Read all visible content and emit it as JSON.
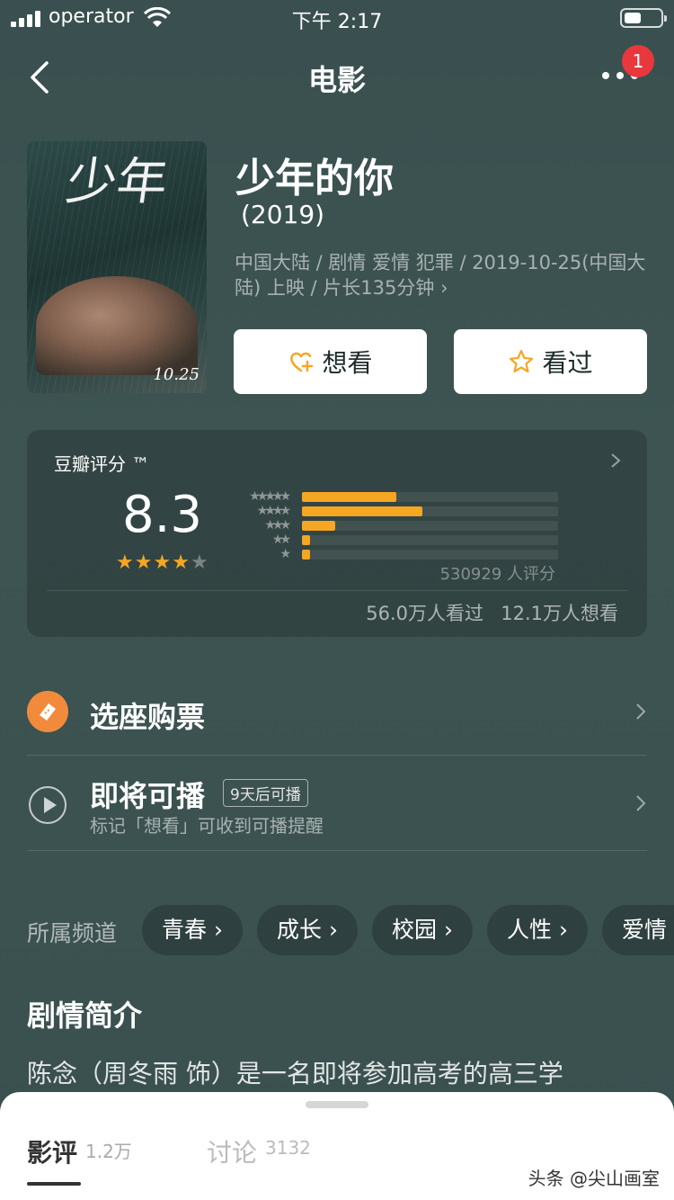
{
  "status_bar": {
    "operator": "operator",
    "time": "下午 2:17"
  },
  "nav": {
    "title": "电影",
    "badge": "1"
  },
  "movie": {
    "title": "少年的你",
    "year": "(2019)",
    "meta": "中国大陆 / 剧情 爱情 犯罪 / 2019-10-25(中国大陆) 上映 / 片长135分钟",
    "poster_date": "10.25",
    "poster_title_glyph": "少年"
  },
  "actions": {
    "want": "想看",
    "seen": "看过"
  },
  "rating": {
    "title": "豆瓣评分 ™",
    "score": "8.3",
    "stars_filled": 4,
    "stars_total": 5,
    "distribution": [
      {
        "stars": "★★★★★",
        "fraction": 0.37
      },
      {
        "stars": "★★★★",
        "fraction": 0.47
      },
      {
        "stars": "★★★",
        "fraction": 0.13
      },
      {
        "stars": "★★",
        "fraction": 0.03
      },
      {
        "stars": "★",
        "fraction": 0.03
      }
    ],
    "count": "530929 人评分",
    "seen": "56.0万人看过",
    "want": "12.1万人想看",
    "bar_color": "#f5a623"
  },
  "rows": {
    "ticket": {
      "title": "选座购票",
      "icon": "ticket-icon"
    },
    "stream": {
      "title": "即将可播",
      "tag": "9天后可播",
      "subtitle": "标记「想看」可收到可播提醒",
      "icon": "play-icon"
    }
  },
  "channels": {
    "label": "所属频道",
    "items": [
      "青春 ›",
      "成长 ›",
      "校园 ›",
      "人性 ›",
      "爱情 ›"
    ]
  },
  "intro": {
    "title": "剧情简介",
    "text": "陈念（周冬雨 饰）是一名即将参加高考的高三学"
  },
  "sheet": {
    "tabs": [
      {
        "label": "影评",
        "count": "1.2万"
      },
      {
        "label": "讨论",
        "count": "3132"
      }
    ]
  },
  "watermark": "头条 @尖山画室"
}
